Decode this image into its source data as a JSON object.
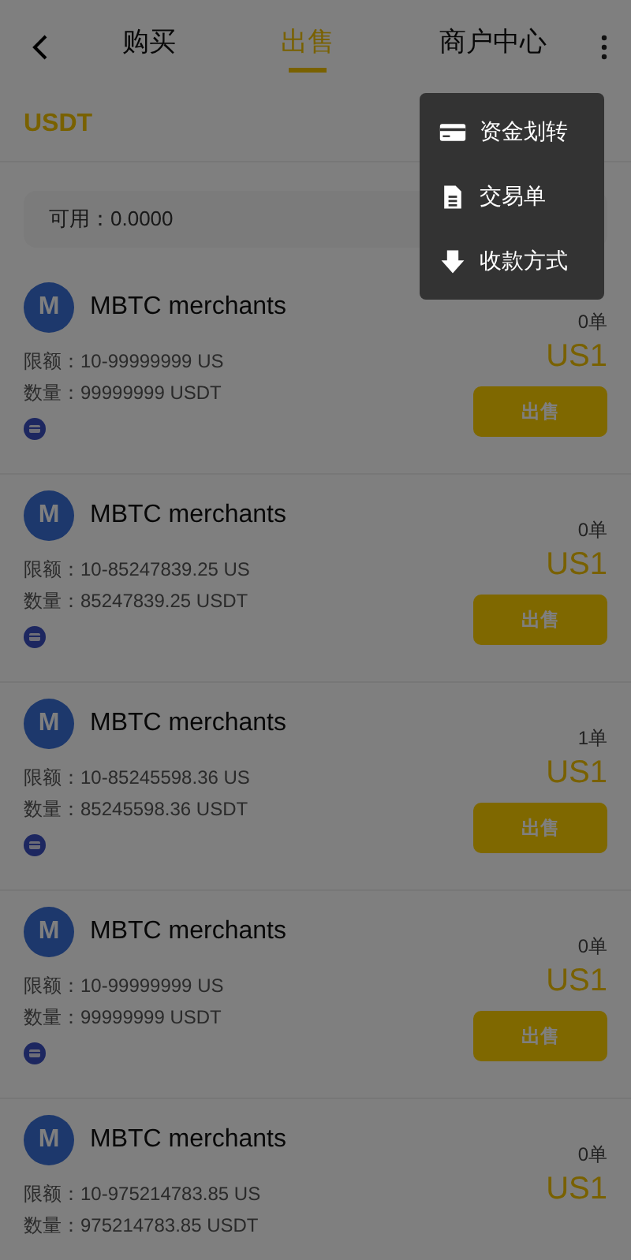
{
  "header": {
    "tabs": [
      {
        "label": "购买",
        "selected": false
      },
      {
        "label": "出售",
        "selected": true
      },
      {
        "label": "商户中心",
        "selected": false
      }
    ]
  },
  "currency": "USDT",
  "balance": "可用：0.0000",
  "merchants": [
    {
      "avatar": "M",
      "name": "MBTC merchants",
      "orders": "0单",
      "limit": "限额：10-99999999 US",
      "quantity": "数量：99999999 USDT",
      "price": "US1",
      "button": "出售",
      "card_payment": true
    },
    {
      "avatar": "M",
      "name": "MBTC merchants",
      "orders": "0单",
      "limit": "限额：10-85247839.25 US",
      "quantity": "数量：85247839.25 USDT",
      "price": "US1",
      "button": "出售",
      "card_payment": true
    },
    {
      "avatar": "M",
      "name": "MBTC merchants",
      "orders": "1单",
      "limit": "限额：10-85245598.36 US",
      "quantity": "数量：85245598.36 USDT",
      "price": "US1",
      "button": "出售",
      "card_payment": true
    },
    {
      "avatar": "M",
      "name": "MBTC merchants",
      "orders": "0单",
      "limit": "限额：10-99999999 US",
      "quantity": "数量：99999999 USDT",
      "price": "US1",
      "button": "出售",
      "card_payment": true
    },
    {
      "avatar": "M",
      "name": "MBTC merchants",
      "orders": "0单",
      "limit": "限额：10-975214783.85 US",
      "quantity": "数量：975214783.85 USDT",
      "price": "US1"
    }
  ],
  "menu": {
    "open": true,
    "items": [
      {
        "kind": "card",
        "label": "资金划转"
      },
      {
        "kind": "document",
        "label": "交易单"
      },
      {
        "kind": "download",
        "label": "收款方式"
      }
    ]
  }
}
